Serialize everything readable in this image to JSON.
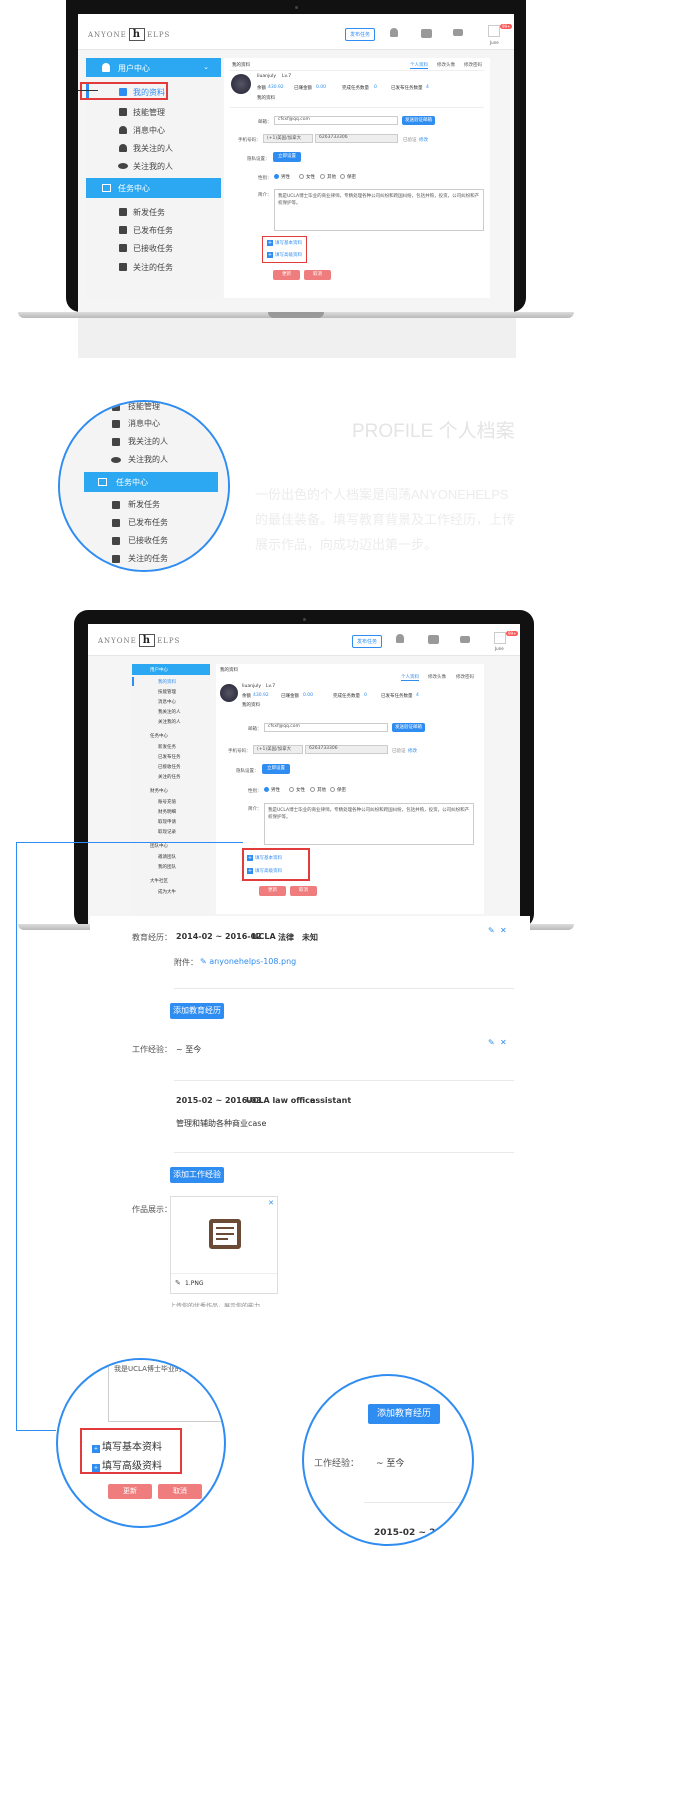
{
  "app": {
    "logo_left": "ANYONE",
    "logo_mark": "h",
    "logo_right": "ELPS",
    "publish_task": "发布任务",
    "user_name": "June",
    "badge": "99+"
  },
  "sidebar": {
    "user_center": "用户中心",
    "my_profile": "我的资料",
    "skills": "技能管理",
    "messages": "消息中心",
    "following": "我关注的人",
    "followers": "关注我的人",
    "task_center": "任务中心",
    "new_task": "新发任务",
    "published": "已发布任务",
    "received": "已接收任务",
    "followed_tasks": "关注的任务",
    "wallet_center": "财务中心",
    "wallet_items": [
      "账号充值",
      "财务明细",
      "取现申请",
      "取现记录"
    ],
    "group_center": "团队中心",
    "group_items": [
      "邀请团队",
      "我的团队"
    ],
    "vip_center": "大牛社区",
    "vip_items": [
      "成为大牛"
    ]
  },
  "profile": {
    "breadcrumb": "我的资料",
    "tabs": [
      "个人资料",
      "修改头像",
      "修改密码"
    ],
    "username": "liuanjuly",
    "level": "Lv.7",
    "balance_label": "余额",
    "balance_value": "430.92",
    "paid_label": "已赚金额",
    "paid_value": "0.00",
    "done_label": "完成任务数量",
    "done_value": "0",
    "published_label": "已发布任务数量",
    "published_value": "4",
    "my_profile_link": "我的资料",
    "email_label": "邮箱：",
    "email_value": "cfsxf@qq.com",
    "email_btn": "发送验证邮箱",
    "phone_label": "手机号码：",
    "phone_code": "(+1)美国/加拿大",
    "phone_value": "6263733306",
    "verified": "已验证",
    "modify": "修改",
    "privacy_label": "隐私设置：",
    "privacy_btn": "立即设置",
    "gender_label": "性别：",
    "genders": [
      "男性",
      "女性",
      "其他",
      "保密"
    ],
    "intro_label": "简介：",
    "intro_text": "我是UCLA博士毕业的商业律师。专精处理各种公司纠纷和跨国纠纷，包括并购，投资，公司纠纷和产权保护等。",
    "fill_basic": "填写基本资料",
    "fill_advanced": "填写高级资料",
    "save": "更新",
    "cancel": "取消"
  },
  "promo": {
    "title": "PROFILE 个人档案",
    "line1": "一份出色的个人档案是闯荡ANYONEHELPS",
    "line2": "的最佳装备。填写教育背景及工作经历，上传",
    "line3": "展示作品，向成功迈出第一步。"
  },
  "details": {
    "edu_label": "教育经历：",
    "edu_period": "2014-02 ~ 2016-02",
    "edu_school": "UCLA",
    "edu_major": "法律",
    "edu_degree": "未知",
    "attach_label": "附件：",
    "attach_file": "anyonehelps-108.png",
    "add_edu": "添加教育经历",
    "work_label": "工作经验：",
    "work_now": "~ 至今",
    "work_period": "2015-02 ~ 2016-08",
    "work_company": "UCLA law office",
    "work_role": "assistant",
    "work_desc": "管理和辅助各种商业case",
    "add_work": "添加工作经验",
    "works_label": "作品展示：",
    "work_file": "1.PNG",
    "cut_text": "上传你的优秀作品，展示你的能力",
    "zoom_intro": "我是UCLA博士毕业的",
    "zoom_period": "2015-02 ~ 2016-0"
  },
  "colors": {
    "accent": "#2f8cf0",
    "header": "#2ba8f1",
    "danger": "#e23b3b",
    "cancel": "#f07d7d"
  }
}
